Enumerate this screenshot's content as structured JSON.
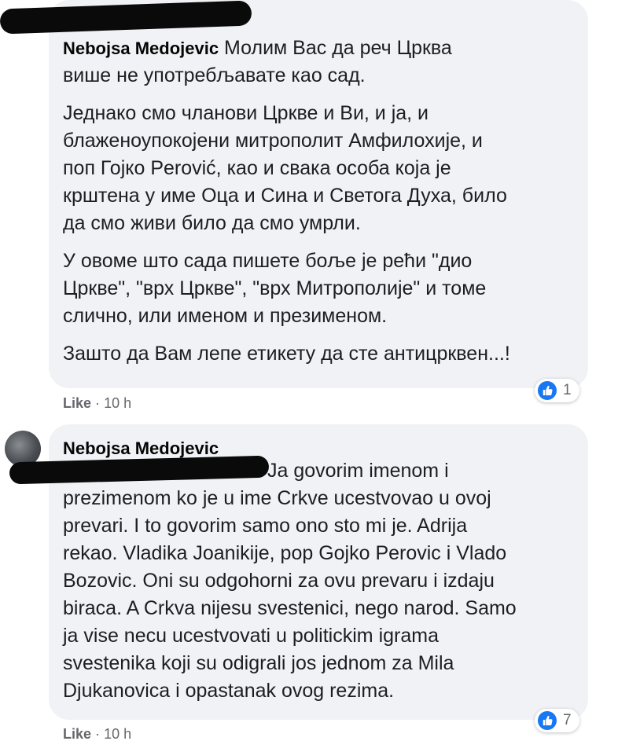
{
  "comments": [
    {
      "author": "Nebojsa Medojevic",
      "paragraphs": [
        [
          "Молим Вас да реч Црква",
          "више не употребљавате као сад."
        ],
        [
          "Једнако смо чланови Цркве и Ви, и ја, и",
          "блаженоупокојени митрополит Амфилохије, и",
          "поп Гојко Perović, као и свака особа која је",
          "крштена у име Оца и Сина и Светога Духа, било",
          "да смо живи било да смо умрли."
        ],
        [
          "У овоме што сада пишете боље је рећи \"дио",
          "Цркве\", \"врх Цркве\", \"врх Митрополије\" и томе",
          "слично, или именом и презименом."
        ],
        [
          "Зашто да Вам лепе етикету да сте антицрквен...!"
        ]
      ],
      "like_label": "Like",
      "separator": "·",
      "time": "10 h",
      "reaction_count": "1",
      "reaction_icon": "thumbs-up-icon"
    },
    {
      "author": "Nebojsa Medojevic",
      "paragraphs": [
        [
          "Ja govorim imenom i",
          "prezimenom ko je u ime Crkve ucestvovao u ovoj",
          "prevari. I to govorim samo ono sto mi je. Adrija",
          "rekao. Vladika Joanikije, pop Gojko Perovic i Vlado",
          "Bozovic. Oni su odgohorni za ovu prevaru i izdaju",
          "biraca. A Crkva nijesu svestenici, nego narod. Samo",
          "ja vise necu ucestvovati u politickim igrama",
          "svestenika koji su odigrali jos jednom za Mila",
          "Djukanovica i opastanak ovog rezima."
        ]
      ],
      "like_label": "Like",
      "separator": "·",
      "time": "10 h",
      "reaction_count": "7",
      "reaction_icon": "thumbs-up-icon"
    }
  ],
  "colors": {
    "bubble": "#f0f2f5",
    "meta": "#65676b",
    "like_blue": "#1877f2"
  }
}
